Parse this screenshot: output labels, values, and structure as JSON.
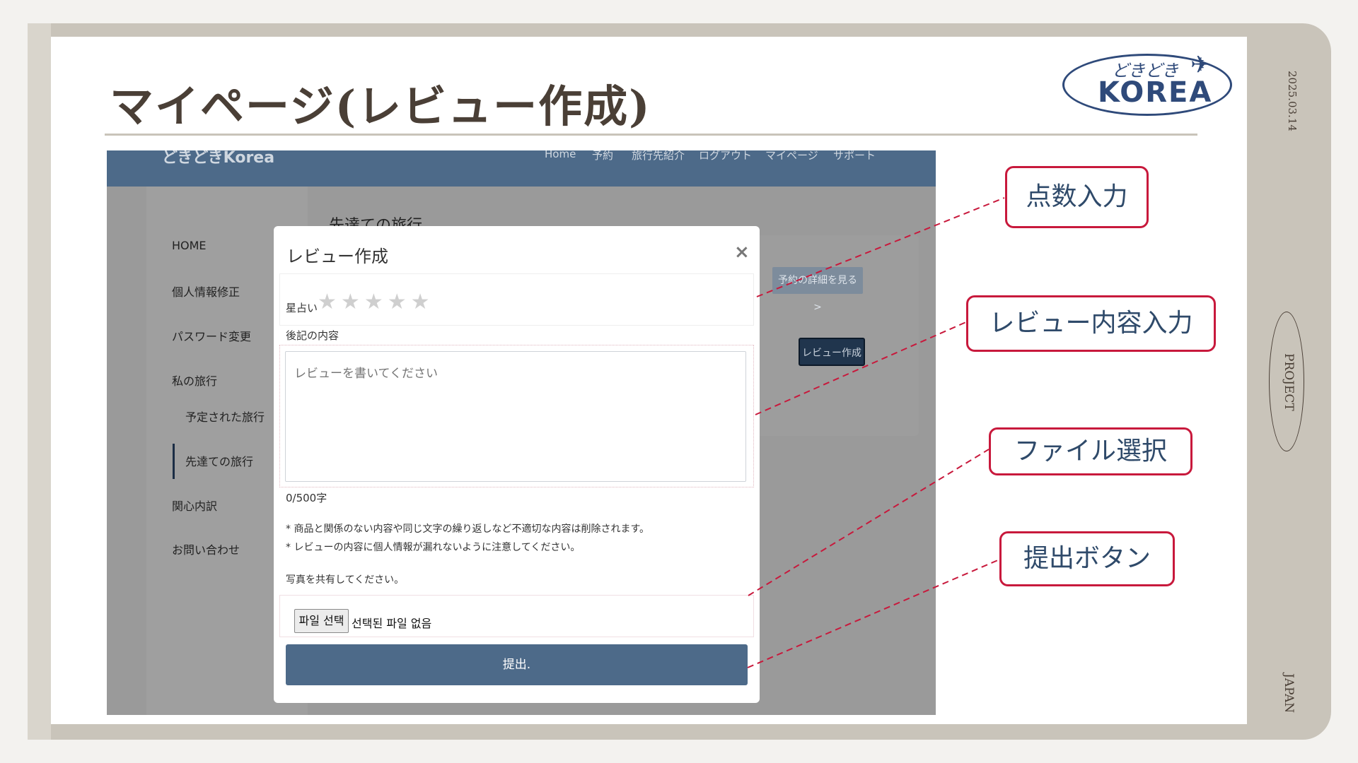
{
  "slide": {
    "title": "マイページ(レビュー作成)",
    "date": "2025.03.14",
    "project": "PROJECT",
    "japan": "JAPAN",
    "logo_top": "どきどき",
    "logo_main": "KOREA"
  },
  "site": {
    "brand": "どきどきKorea",
    "nav": [
      "Home",
      "予約",
      "旅行先紹介",
      "ログアウト",
      "マイページ",
      "サポート"
    ],
    "sidebar": [
      "HOME",
      "個人情報修正",
      "パスワード変更",
      "私の旅行",
      "予定された旅行",
      "先達ての旅行",
      "関心内訳",
      "お問い合わせ"
    ],
    "heading": "先達ての旅行",
    "detail_button": "予約の詳細を見る >",
    "review_button": "レビュー作成"
  },
  "modal": {
    "title": "レビュー作成",
    "close": "×",
    "rating_label": "星占い",
    "star_count": 5,
    "content_label": "後記の内容",
    "placeholder": "レビューを書いてください",
    "counter": "0/500字",
    "note1": "* 商品と関係のない内容や同じ文字の繰り返しなど不適切な内容は削除されます。",
    "note2": "* レビューの内容に個人情報が漏れないように注意してください。",
    "share_label": "写真を共有してください。",
    "file_button": "파일 선택",
    "file_status": "선택된 파일 없음",
    "submit": "提出."
  },
  "callouts": {
    "score": "点数入力",
    "review": "レビュー内容入力",
    "file": "ファイル選択",
    "submit": "提出ボタン"
  },
  "colors": {
    "accent": "#c8193c",
    "nav": "#4d6a89",
    "frame": "#c9c4ba"
  }
}
